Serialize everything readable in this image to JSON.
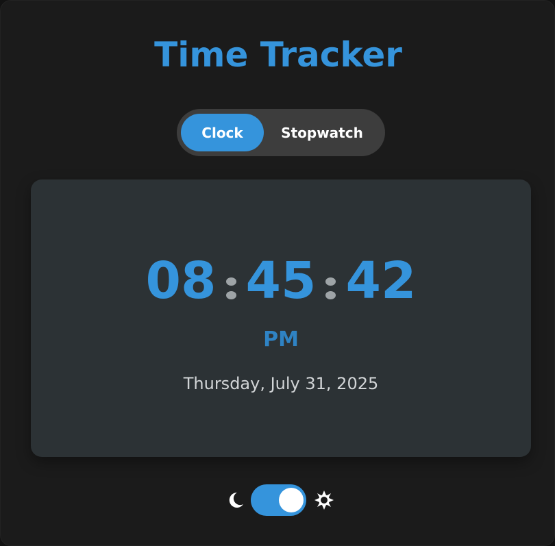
{
  "app": {
    "title": "Time Tracker"
  },
  "mode_toggle": {
    "options": [
      {
        "label": "Clock",
        "active": true
      },
      {
        "label": "Stopwatch",
        "active": false
      }
    ]
  },
  "clock": {
    "hours": "08",
    "minutes": "45",
    "seconds": "42",
    "period": "PM",
    "date": "Thursday, July 31, 2025"
  },
  "theme_toggle": {
    "left_icon": "moon-icon",
    "right_icon": "sun-icon",
    "state": "on"
  },
  "colors": {
    "accent": "#3594dc",
    "background": "#1b1b1b",
    "card": "#2c3235",
    "toggle_track": "#3d3d3d"
  }
}
